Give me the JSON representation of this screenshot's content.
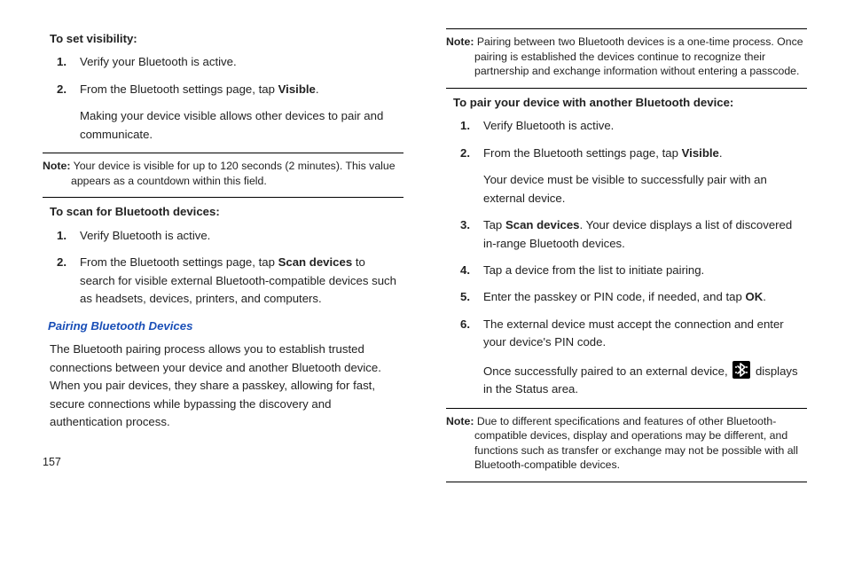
{
  "column_left": {
    "section1": {
      "title": "To set visibility:",
      "steps": [
        "Verify your Bluetooth is active.",
        "From the Bluetooth settings page, tap "
      ],
      "step2_bold": "Visible",
      "step2_after": ".",
      "after_step2": "Making your device visible allows other devices to pair and communicate."
    },
    "note1_label": "Note:",
    "note1_text": " Your device is visible for up to 120 seconds (2 minutes). This value appears as a countdown within this field.",
    "section2": {
      "title": "To scan for Bluetooth devices:",
      "steps": [
        "Verify Bluetooth is active.",
        "From the Bluetooth settings page, tap "
      ],
      "step2_bold": "Scan devices",
      "step2_after": " to search for visible external Bluetooth-compatible devices such as headsets, devices, printers, and computers."
    },
    "subhead": "Pairing Bluetooth Devices",
    "pairing_para": "The Bluetooth pairing process allows you to establish trusted connections between your device and another Bluetooth device. When you pair devices, they share a passkey, allowing for fast, secure connections while bypassing the discovery and authentication process."
  },
  "column_right": {
    "note1_label": "Note:",
    "note1_text": " Pairing between two Bluetooth devices is a one-time process. Once pairing is established the devices continue to recognize their partnership and exchange information without entering a passcode.",
    "section": {
      "title": "To pair your device with another Bluetooth device:",
      "step1": "Verify Bluetooth is active.",
      "step2_before": "From the Bluetooth settings page, tap ",
      "step2_bold": "Visible",
      "step2_after": ".",
      "step2_cont": "Your device must be visible to successfully pair with an external device.",
      "step3_before": "Tap ",
      "step3_bold": "Scan devices",
      "step3_after": ". Your device displays a list of discovered in-range Bluetooth devices.",
      "step4": "Tap a device from the list to initiate pairing.",
      "step5_before": "Enter the passkey or PIN code, if needed, and tap ",
      "step5_bold": "OK",
      "step5_after": ".",
      "step6": "The external device must accept the connection and enter your device's PIN code.",
      "step6_cont_before": "Once successfully paired to an external device, ",
      "step6_cont_after": " displays in the Status area."
    },
    "note2_label": "Note:",
    "note2_text": " Due to different specifications and features of other Bluetooth-compatible devices, display and operations may be different, and functions such as transfer or exchange may not be possible with all Bluetooth-compatible devices."
  },
  "page_number": "157"
}
